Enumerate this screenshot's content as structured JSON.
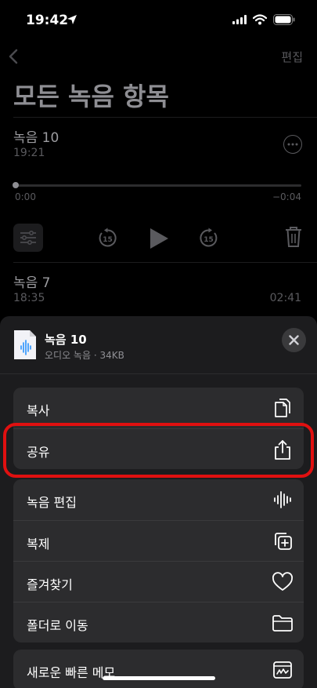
{
  "status_bar": {
    "time": "19:42"
  },
  "nav": {
    "edit_label": "편집"
  },
  "page": {
    "title": "모든 녹음 항목"
  },
  "recordings": [
    {
      "title": "녹음 10",
      "date": "19:21",
      "elapsed": "0:00",
      "remaining": "−0:04"
    },
    {
      "title": "녹음 7",
      "date": "18:35",
      "duration": "02:41"
    }
  ],
  "player": {
    "skip_back_seconds": "15",
    "skip_forward_seconds": "15"
  },
  "sheet": {
    "file_title": "녹음 10",
    "file_subtitle": "오디오 녹음 · 34KB",
    "group1": [
      {
        "label": "복사",
        "icon": "copy-icon"
      },
      {
        "label": "공유",
        "icon": "share-icon"
      }
    ],
    "group2": [
      {
        "label": "녹음 편집",
        "icon": "waveform-icon"
      },
      {
        "label": "복제",
        "icon": "duplicate-icon"
      },
      {
        "label": "즐겨찾기",
        "icon": "heart-icon"
      },
      {
        "label": "폴더로 이동",
        "icon": "folder-icon"
      }
    ],
    "group3": [
      {
        "label": "새로운 빠른 메모",
        "icon": "quick-note-icon"
      }
    ]
  },
  "colors": {
    "highlight": "#e01010",
    "accent_blue": "#0a84ff"
  }
}
